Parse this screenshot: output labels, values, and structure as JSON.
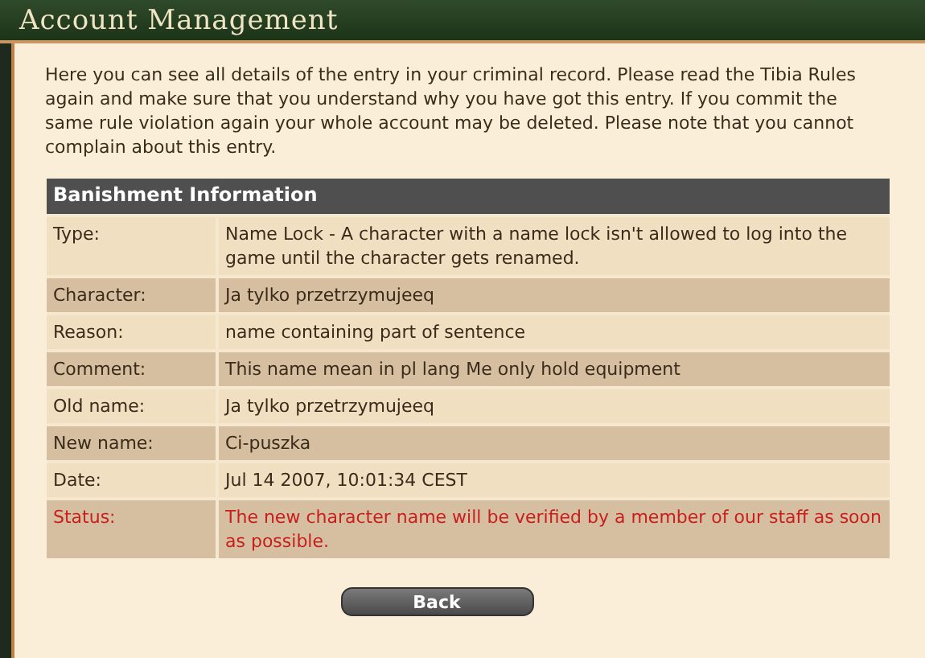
{
  "window": {
    "title": "Account Management"
  },
  "intro": "Here you can see all details of the entry in your criminal record. Please read the Tibia Rules again and make sure that you understand why you have got this entry. If you commit the same rule violation again your whole account may be deleted. Please note that you cannot complain about this entry.",
  "table": {
    "title": "Banishment Information",
    "rows": [
      {
        "label": "Type:",
        "value": "Name Lock - A character with a name lock isn't allowed to log into the game until the character gets renamed.",
        "kind": "normal"
      },
      {
        "label": "Character:",
        "value": "Ja tylko przetrzymujeeq",
        "kind": "normal"
      },
      {
        "label": "Reason:",
        "value": "name containing part of sentence",
        "kind": "normal"
      },
      {
        "label": "Comment:",
        "value": "This name mean in pl lang Me only hold equipment",
        "kind": "normal"
      },
      {
        "label": "Old name:",
        "value": "Ja tylko przetrzymujeeq",
        "kind": "normal"
      },
      {
        "label": "New name:",
        "value": "Ci-puszka",
        "kind": "normal"
      },
      {
        "label": "Date:",
        "value": "Jul 14 2007, 10:01:34 CEST",
        "kind": "normal"
      },
      {
        "label": "Status:",
        "value": "The new character name will be verified by a member of our staff as soon as possible.",
        "kind": "alert"
      }
    ]
  },
  "buttons": [
    "Back"
  ]
}
